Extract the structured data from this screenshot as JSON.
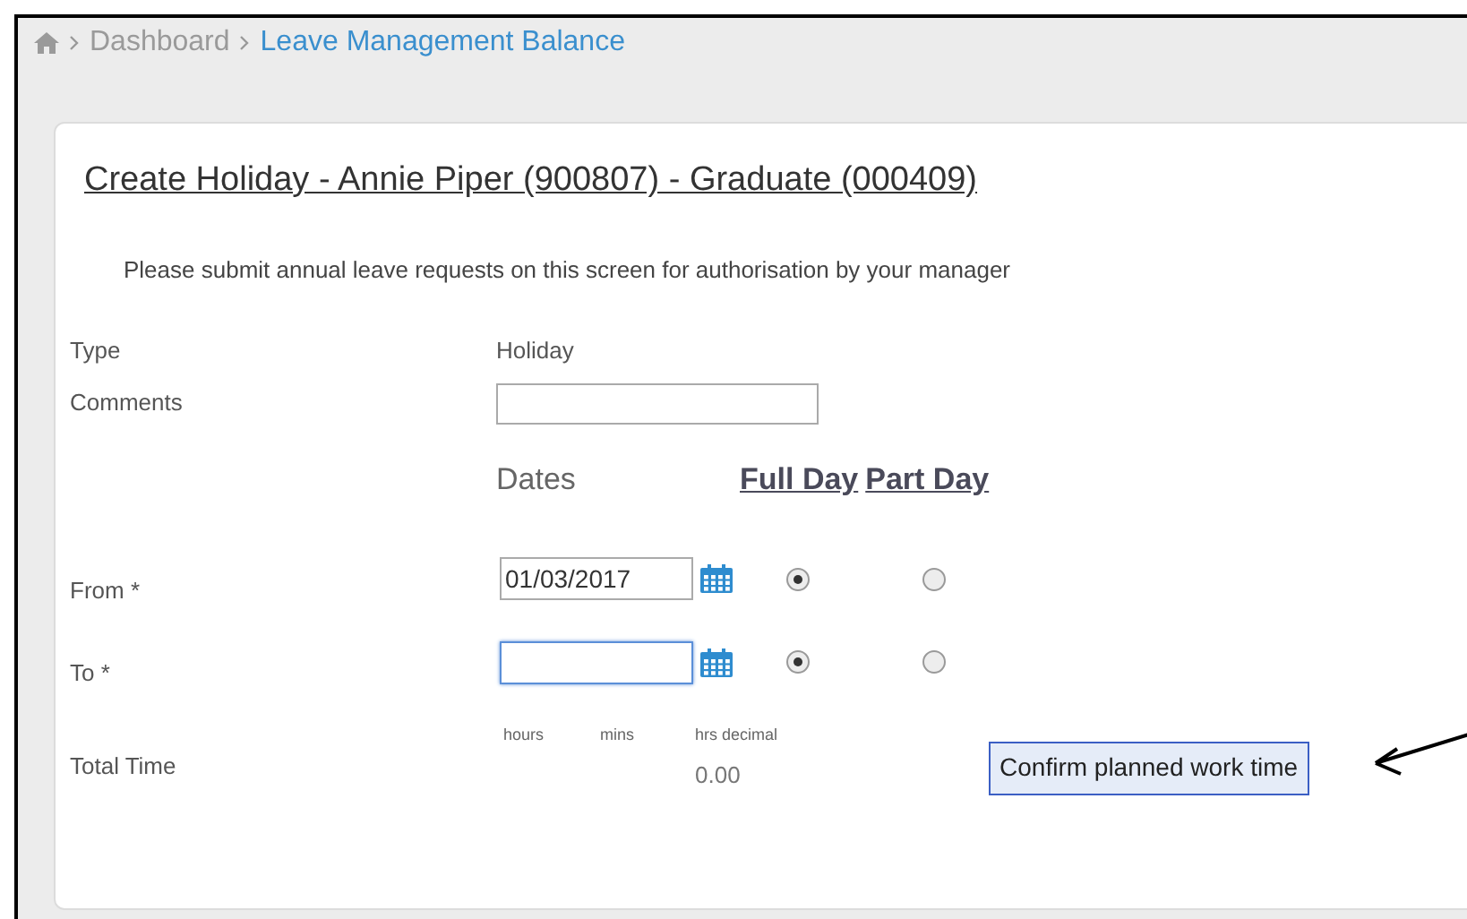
{
  "breadcrumb": [
    {
      "label": "Dashboard",
      "current": false
    },
    {
      "label": "Leave Management Balance",
      "current": true
    }
  ],
  "form": {
    "title": "Create Holiday - Annie Piper (900807) - Graduate (000409)",
    "instruction": "Please submit annual leave requests on this screen for authorisation by your manager",
    "type_label": "Type",
    "type_value": "Holiday",
    "comments_label": "Comments",
    "dates_heading": "Dates",
    "full_day_heading": "Full Day",
    "part_day_heading": "Part Day",
    "date_rows": [
      {
        "label": "From *",
        "value": "01/03/2017",
        "focused": false,
        "full_day_selected": true,
        "part_day_selected": false
      },
      {
        "label": "To *",
        "value": "",
        "focused": true,
        "full_day_selected": true,
        "part_day_selected": false
      }
    ],
    "total_label": "Total Time",
    "hours_label": "hours",
    "mins_label": "mins",
    "decimal_label": "hrs decimal",
    "decimal_value": "0.00",
    "confirm_button": "Confirm planned work time"
  }
}
